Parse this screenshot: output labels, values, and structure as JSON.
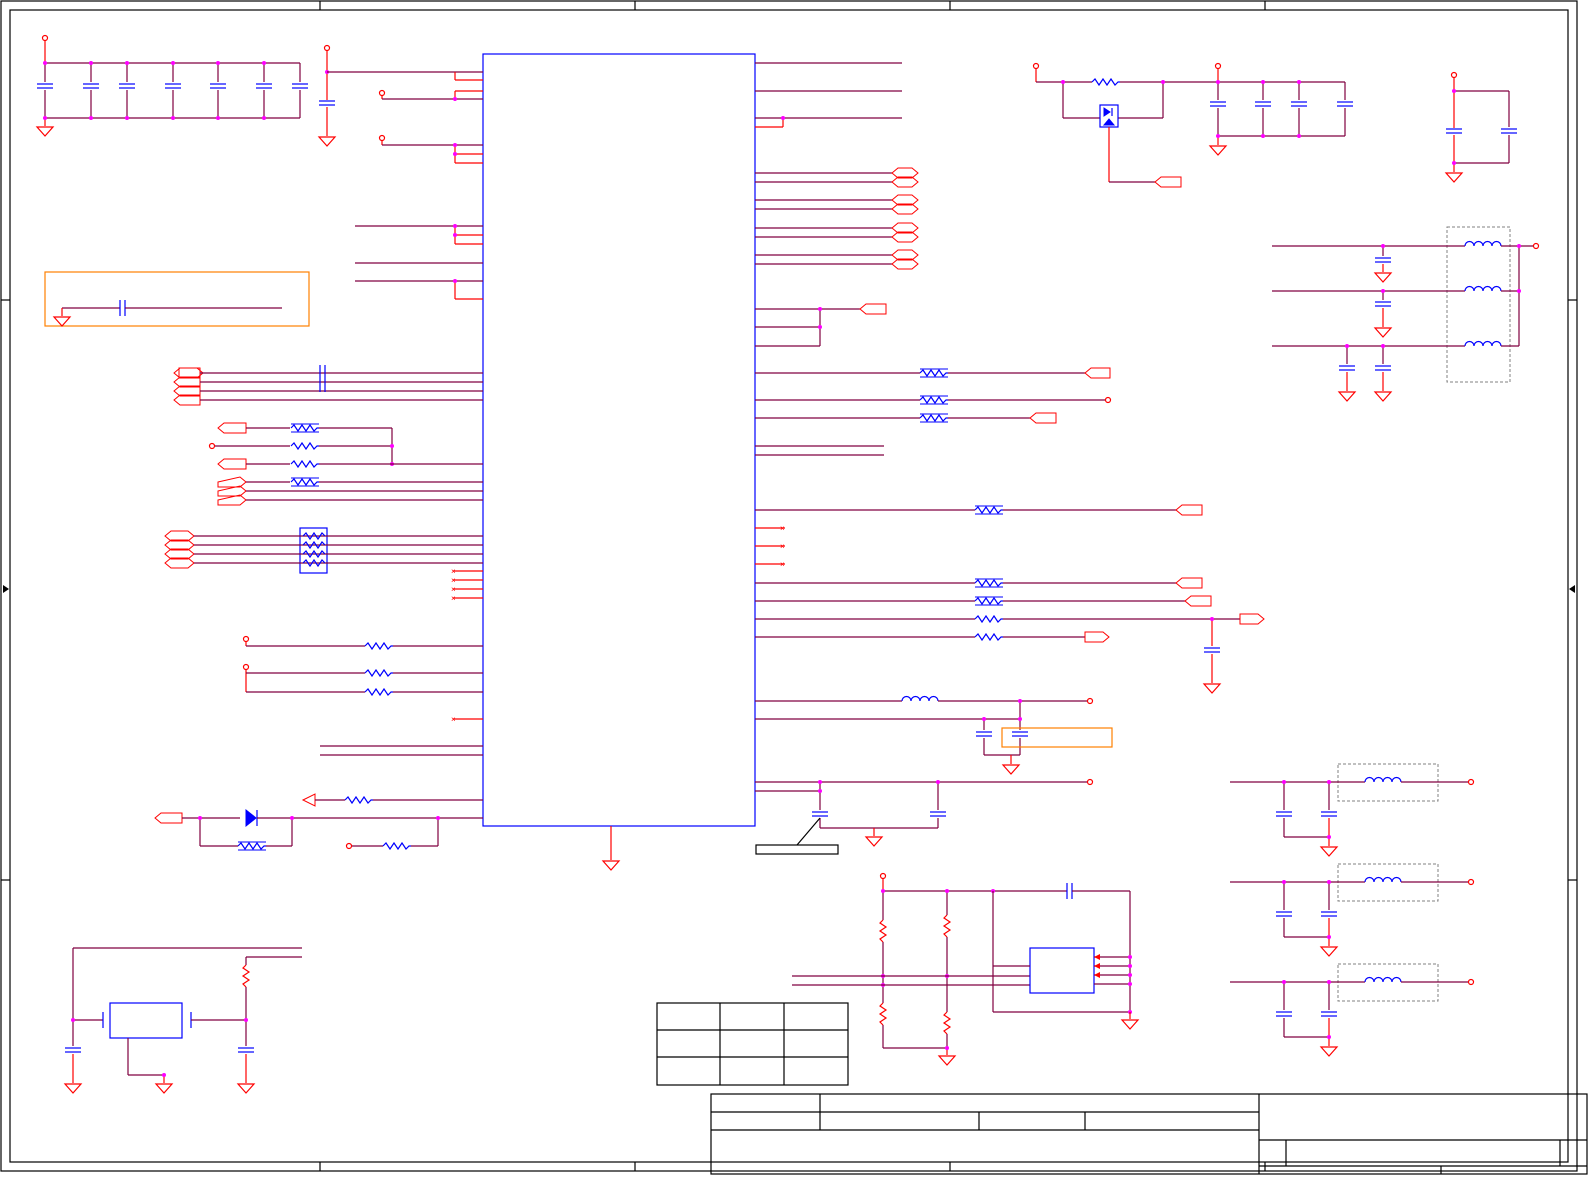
{
  "sheet": {
    "title_block": {
      "title": "",
      "size": "",
      "document_number": "",
      "revision": "",
      "date": "",
      "sheet_of": ""
    },
    "colors": {
      "frame": "#000000",
      "wire": "#800040",
      "pin": "#ff0000",
      "component": "#0000ff",
      "junction": "#ff00ff",
      "note_box": "#ff8000",
      "shield": "#808080"
    }
  }
}
